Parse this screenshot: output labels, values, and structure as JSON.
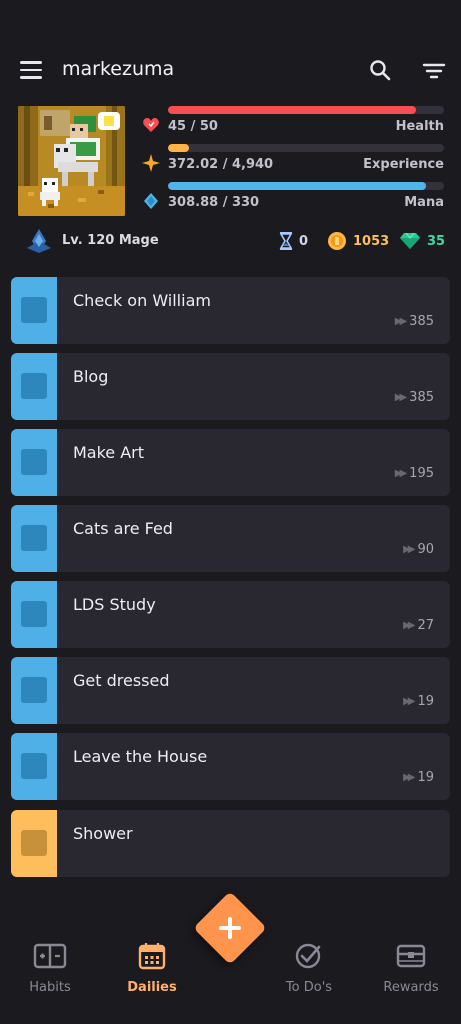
{
  "header": {
    "username": "markezuma",
    "menu_icon": "hamburger-menu-icon",
    "search_icon": "search-icon",
    "filter_icon": "filter-icon"
  },
  "stats": {
    "health": {
      "value_text": "45 / 50",
      "label": "Health",
      "fraction": 0.9,
      "color": "#f74e52"
    },
    "experience": {
      "value_text": "372.02 / 4,940",
      "label": "Experience",
      "fraction": 0.075,
      "color": "#ffb445"
    },
    "mana": {
      "value_text": "308.88 / 330",
      "label": "Mana",
      "fraction": 0.936,
      "color": "#50b5e9"
    }
  },
  "level": {
    "text": "Lv. 120 Mage"
  },
  "currencies": {
    "hourglass": {
      "value": "0",
      "color": "#a4c8ff"
    },
    "gold": {
      "value": "1053",
      "color": "#ffbe5c"
    },
    "gems": {
      "value": "35",
      "color": "#24cc8f"
    }
  },
  "dailies": [
    {
      "title": "Check on William",
      "streak": "385",
      "color": "blue"
    },
    {
      "title": "Blog",
      "streak": "385",
      "color": "blue"
    },
    {
      "title": "Make Art",
      "streak": "195",
      "color": "blue"
    },
    {
      "title": "Cats are Fed",
      "streak": "90",
      "color": "blue"
    },
    {
      "title": "LDS Study",
      "streak": "27",
      "color": "blue"
    },
    {
      "title": "Get dressed",
      "streak": "19",
      "color": "blue"
    },
    {
      "title": "Leave the House",
      "streak": "19",
      "color": "blue"
    },
    {
      "title": "Shower",
      "streak": "",
      "color": "yellow"
    }
  ],
  "nav": {
    "habits": "Habits",
    "dailies": "Dailies",
    "todos": "To Do's",
    "rewards": "Rewards",
    "active": "dailies"
  },
  "fab": {
    "icon": "plus-icon",
    "color": "#ff944c"
  }
}
